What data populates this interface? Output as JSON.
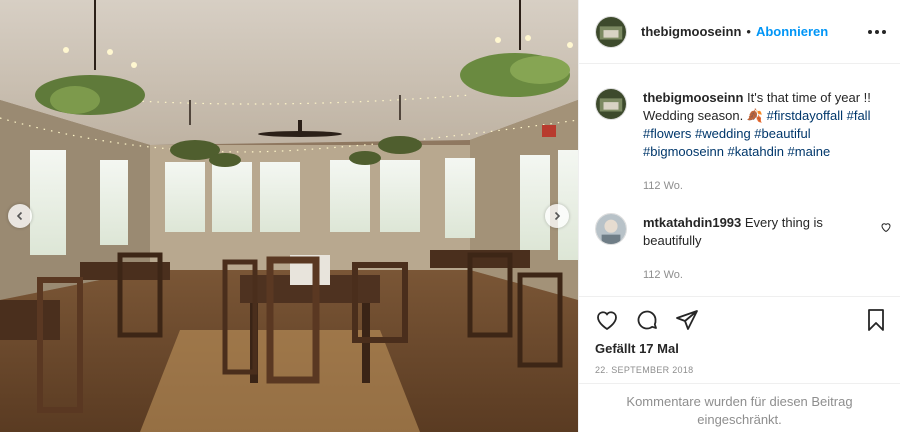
{
  "post": {
    "username": "thebigmooseinn",
    "follow_label": "Abonnieren",
    "separator": "•",
    "caption_text": "It's that time of year !! Wedding season. 🍂",
    "caption_tags": "#firstdayoffall #fall #flowers #wedding #beautiful #bigmooseinn #katahdin #maine",
    "caption_time": "112 Wo.",
    "image_alt": "Wedding dining room with chandeliers and wooden tables"
  },
  "comments": [
    {
      "username": "mtkatahdin1993",
      "text": "Every thing is beautifully",
      "time": "112 Wo."
    }
  ],
  "actions": {
    "likes": "Gefällt 17 Mal",
    "date": "22. SEPTEMBER 2018",
    "comments_limited": "Kommentare wurden für diesen Beitrag eingeschränkt."
  },
  "icons": {
    "more": "more-options-icon",
    "heart": "heart-icon",
    "comment": "comment-icon",
    "share": "share-icon",
    "bookmark": "bookmark-icon",
    "prev": "chevron-left-icon",
    "next": "chevron-right-icon"
  },
  "colors": {
    "link": "#0095f6",
    "hashtag": "#00376b",
    "muted": "#8e8e8e"
  }
}
